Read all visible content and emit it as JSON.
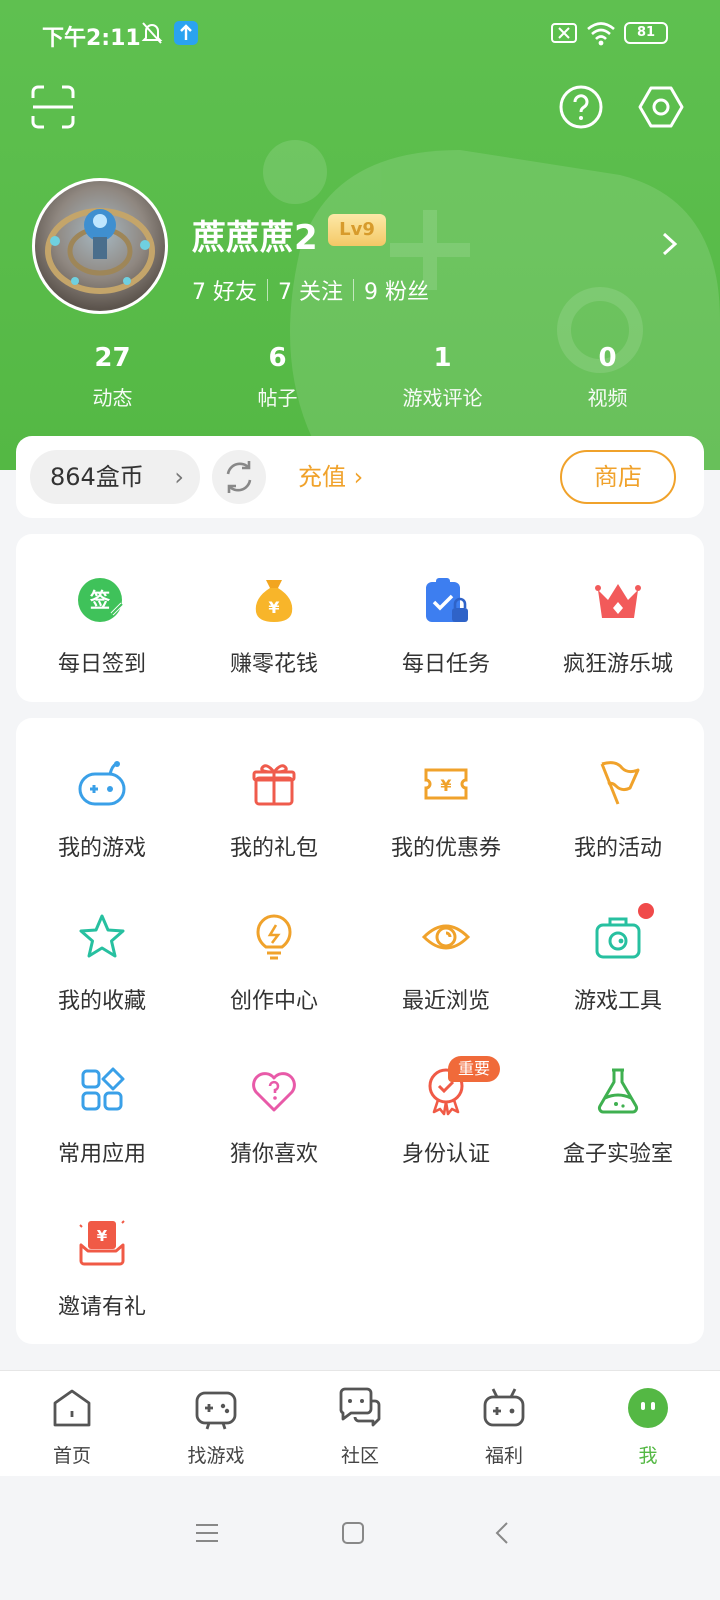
{
  "status_bar": {
    "time": "下午2:11",
    "battery": "81"
  },
  "profile": {
    "username": "蔗蔗蔗2",
    "level": "Lv9",
    "friends": "7 好友",
    "following": "7 关注",
    "fans": "9 粉丝"
  },
  "stats": [
    {
      "value": "27",
      "label": "动态"
    },
    {
      "value": "6",
      "label": "帖子"
    },
    {
      "value": "1",
      "label": "游戏评论"
    },
    {
      "value": "0",
      "label": "视频"
    }
  ],
  "wallet": {
    "coins": "864盒币",
    "recharge": "充值",
    "shop": "商店"
  },
  "quick_actions": [
    {
      "label": "每日签到",
      "icon": "sign-in-icon"
    },
    {
      "label": "赚零花钱",
      "icon": "money-bag-icon"
    },
    {
      "label": "每日任务",
      "icon": "task-clipboard-icon"
    },
    {
      "label": "疯狂游乐城",
      "icon": "crown-icon"
    }
  ],
  "features": [
    {
      "label": "我的游戏",
      "icon": "gamepad-icon"
    },
    {
      "label": "我的礼包",
      "icon": "gift-icon"
    },
    {
      "label": "我的优惠券",
      "icon": "coupon-icon"
    },
    {
      "label": "我的活动",
      "icon": "flag-icon"
    },
    {
      "label": "我的收藏",
      "icon": "star-icon"
    },
    {
      "label": "创作中心",
      "icon": "lightbulb-icon"
    },
    {
      "label": "最近浏览",
      "icon": "eye-icon"
    },
    {
      "label": "游戏工具",
      "icon": "toolbox-icon"
    },
    {
      "label": "常用应用",
      "icon": "apps-icon"
    },
    {
      "label": "猜你喜欢",
      "icon": "heart-question-icon"
    },
    {
      "label": "身份认证",
      "icon": "verify-badge-icon",
      "tag": "重要"
    },
    {
      "label": "盒子实验室",
      "icon": "flask-icon"
    },
    {
      "label": "邀请有礼",
      "icon": "invite-gift-icon"
    }
  ],
  "tabs": [
    {
      "label": "首页",
      "icon": "home-icon"
    },
    {
      "label": "找游戏",
      "icon": "controller-icon"
    },
    {
      "label": "社区",
      "icon": "chat-icon"
    },
    {
      "label": "福利",
      "icon": "tv-gamepad-icon"
    },
    {
      "label": "我",
      "icon": "me-face-icon",
      "active": true
    }
  ],
  "colors": {
    "brand_green": "#54b844",
    "accent_orange": "#f0a22b",
    "alert_red": "#f04a4a"
  }
}
